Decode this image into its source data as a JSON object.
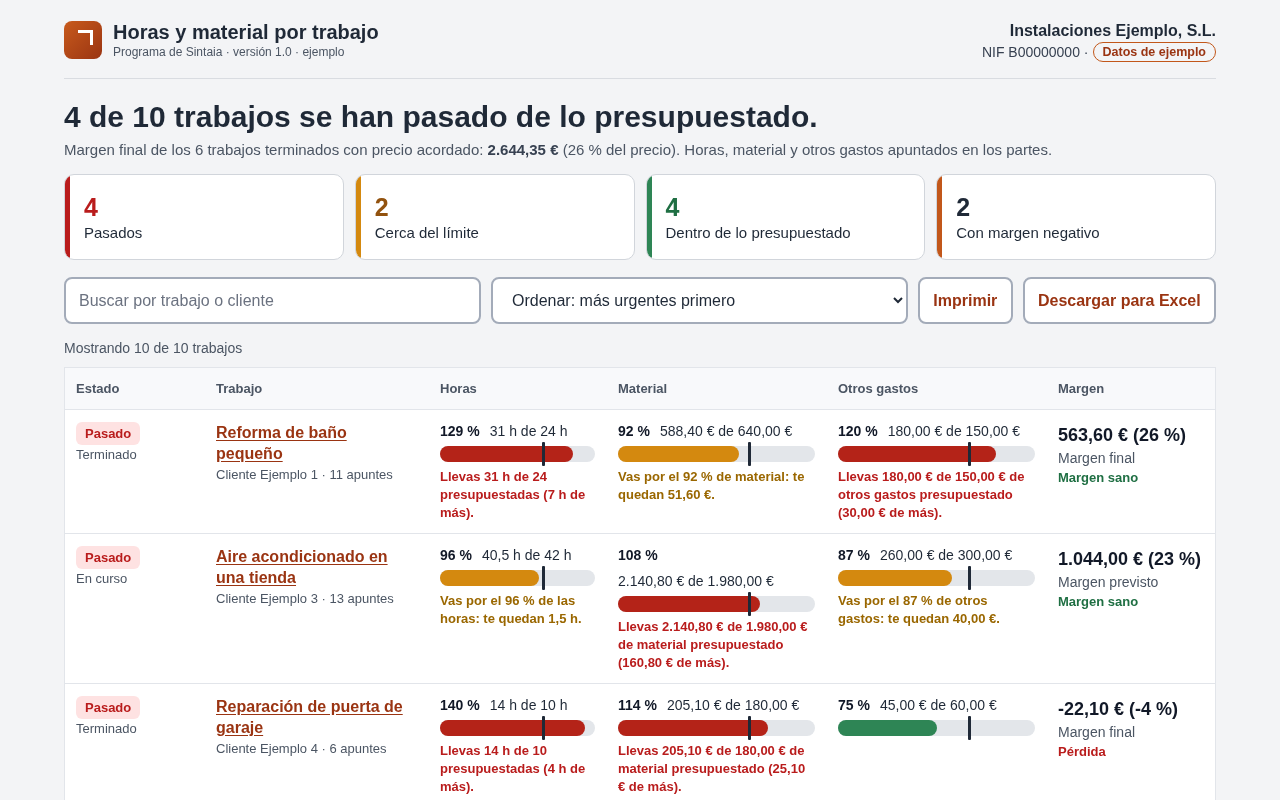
{
  "header": {
    "title": "Horas y material por trabajo",
    "subtitle": "Programa de Sintaia · versión 1.0 · ejemplo",
    "company": "Instalaciones Ejemplo, S.L.",
    "tax_id": "NIF B00000000 ·",
    "badge": "Datos de ejemplo"
  },
  "summary": {
    "headline": "4 de 10 trabajos se han pasado de lo presupuestado.",
    "note": "Margen final de los 6 trabajos terminados con precio acordado: **2.644,35 €** (26 % del precio). Horas, material y otros gastos apuntados en los partes."
  },
  "cards": [
    {
      "count": "4",
      "label": "Pasados",
      "color": "#b91c1c",
      "kind": "over"
    },
    {
      "count": "2",
      "label": "Cerca del límite",
      "color": "#d4890f",
      "kind": "near"
    },
    {
      "count": "4",
      "label": "Dentro de lo presupuestado",
      "color": "#2e8555",
      "kind": "ok"
    },
    {
      "count": "2",
      "label": "Con margen negativo",
      "color": "#c2571a",
      "kind": "plain"
    }
  ],
  "toolbar": {
    "search": {
      "placeholder": "Buscar por trabajo o cliente"
    },
    "sort": "Ordenar: más urgentes primero",
    "buttons": [
      "Imprimir",
      "Descargar para Excel"
    ]
  },
  "result_count": "Mostrando 10 de 10 trabajos",
  "table": {
    "columns": [
      "Estado",
      "Trabajo",
      "Horas",
      "Material",
      "Otros gastos",
      "Margen"
    ],
    "rows": [
      {
        "status": {
          "label": "Pasado",
          "kind": "over"
        },
        "stage": "Terminado",
        "job": "Reforma de baño pequeño",
        "client": "Cliente Ejemplo 1 · 11 apuntes",
        "meters": [
          {
            "percent": "129 %",
            "amount": "31 h de 24 h",
            "level": 0.86,
            "kind": "over",
            "message": "Llevas 31 h de 24 presupuestadas (7 h de más)."
          },
          {
            "percent": "92 %",
            "amount": "588,40 € de 640,00 €",
            "level": 0.613,
            "kind": "near",
            "message": "Vas por el 92 % de material: te quedan 51,60 €."
          },
          {
            "percent": "120 %",
            "amount": "180,00 € de 150,00 €",
            "level": 0.8,
            "kind": "over",
            "message": "Llevas 180,00 € de 150,00 € de otros gastos presupuestado (30,00 € de más)."
          }
        ],
        "margin": {
          "value": "563,60 € (26 %)",
          "label": "Margen final",
          "verdict": "Margen sano",
          "kind": "good"
        }
      },
      {
        "status": {
          "label": "Pasado",
          "kind": "over"
        },
        "stage": "En curso",
        "job": "Aire acondicionado en una tienda",
        "client": "Cliente Ejemplo 3 · 13 apuntes",
        "meters": [
          {
            "percent": "96 %",
            "amount": "40,5 h de 42 h",
            "level": 0.64,
            "kind": "near",
            "message": "Vas por el 96 % de las horas: te quedan 1,5 h."
          },
          {
            "percent": "108 %",
            "amount": "2.140,80 € de 1.980,00 €",
            "level": 0.72,
            "kind": "over",
            "message": "Llevas 2.140,80 € de 1.980,00 € de material presupuestado (160,80 € de más)."
          },
          {
            "percent": "87 %",
            "amount": "260,00 € de 300,00 €",
            "level": 0.58,
            "kind": "near",
            "message": "Vas por el 87 % de otros gastos: te quedan 40,00 €."
          }
        ],
        "margin": {
          "value": "1.044,00 € (23 %)",
          "label": "Margen previsto",
          "verdict": "Margen sano",
          "kind": "good"
        }
      },
      {
        "status": {
          "label": "Pasado",
          "kind": "over"
        },
        "stage": "Terminado",
        "job": "Reparación de puerta de garaje",
        "client": "Cliente Ejemplo 4 · 6 apuntes",
        "meters": [
          {
            "percent": "140 %",
            "amount": "14 h de 10 h",
            "level": 0.933,
            "kind": "over",
            "message": "Llevas 14 h de 10 presupuestadas (4 h de más)."
          },
          {
            "percent": "114 %",
            "amount": "205,10 € de 180,00 €",
            "level": 0.76,
            "kind": "over",
            "message": "Llevas 205,10 € de 180,00 € de material presupuestado (25,10 € de más)."
          },
          {
            "percent": "75 %",
            "amount": "45,00 € de 60,00 €",
            "level": 0.5,
            "kind": "ok"
          }
        ],
        "margin": {
          "value": "-22,10 € (-4 %)",
          "label": "Margen final",
          "verdict": "Pérdida",
          "kind": "loss"
        }
      }
    ]
  }
}
